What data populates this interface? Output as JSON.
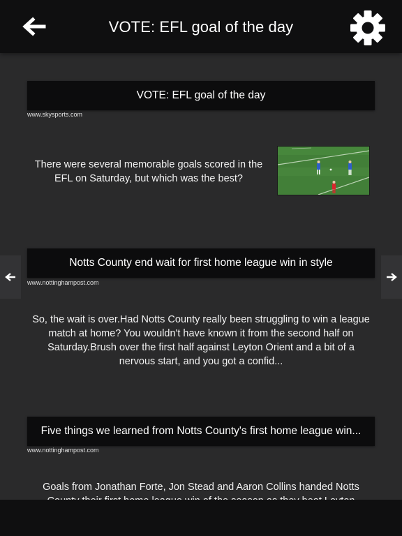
{
  "header": {
    "title": "VOTE: EFL goal of the day",
    "back_icon": "back-arrow-icon",
    "settings_icon": "gear-icon"
  },
  "articles": [
    {
      "headline": "VOTE: EFL goal of the day",
      "source": "www.skysports.com",
      "summary": "There were several memorable goals scored in the EFL on Saturday, but which was the best?"
    },
    {
      "headline": "Notts County end wait for first home league win in style",
      "source": "www.nottinghampost.com",
      "summary": "So, the wait is over.Had Notts County really been struggling to win a league match at home? You wouldn't have known it from the second half on Saturday.Brush over the first half against Leyton Orient and a bit of a nervous start, and you got a confid..."
    },
    {
      "headline": "Five things we learned from Notts County's first home league win...",
      "source": "www.nottinghampost.com",
      "summary": "Goals from Jonathan Forte, Jon Stead and Aaron Collins handed Notts County their first home league win of the season as they beat Leyton Orient..."
    }
  ],
  "nav": {
    "prev_icon": "left-arrow-icon",
    "next_icon": "right-arrow-icon"
  }
}
